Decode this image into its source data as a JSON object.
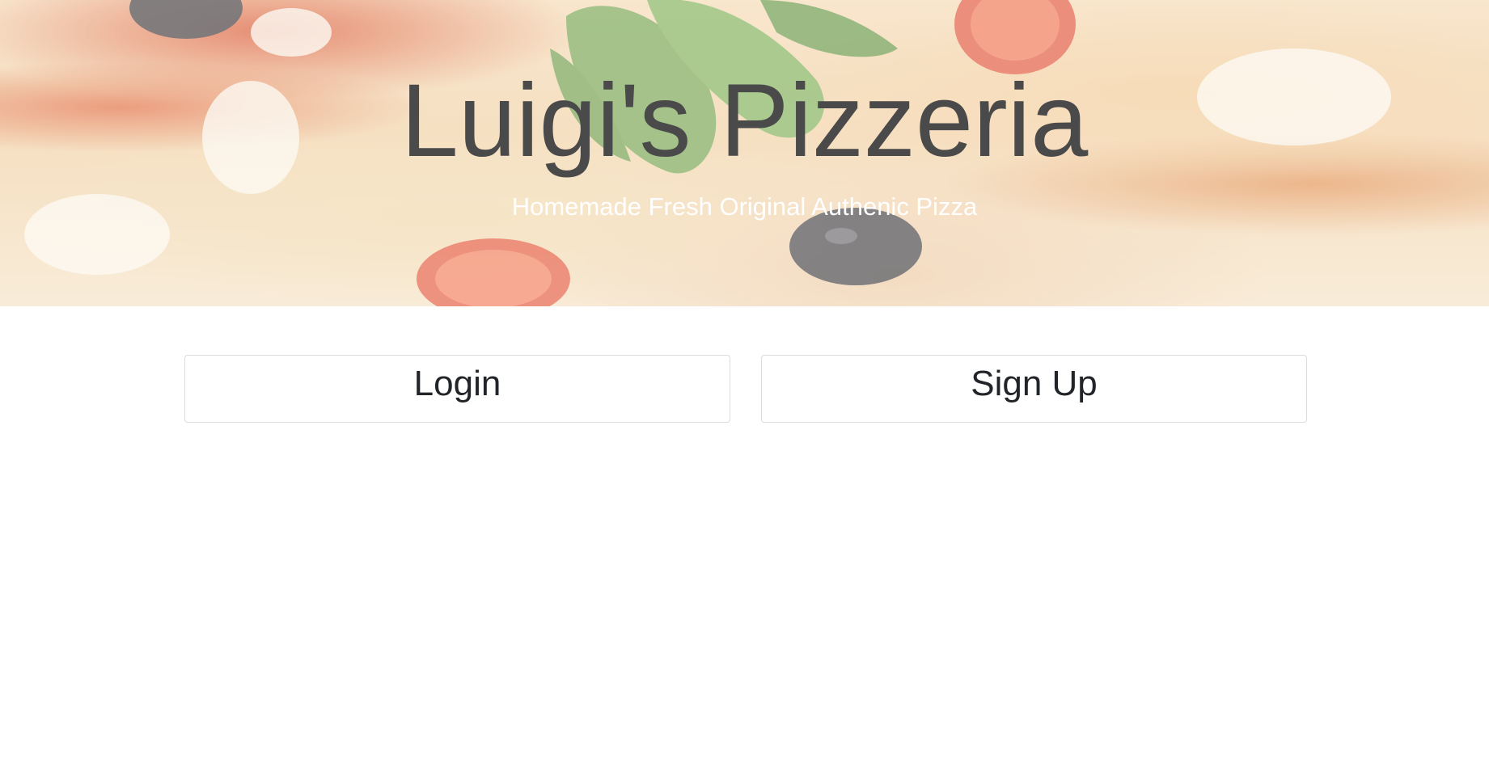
{
  "hero": {
    "title": "Luigi's Pizzeria",
    "subtitle": "Homemade Fresh Original Authenic Pizza",
    "background_image": "pizza-photo"
  },
  "actions": {
    "login_label": "Login",
    "signup_label": "Sign Up"
  },
  "colors": {
    "title_text": "#4a4a4a",
    "subtitle_text": "#ffffff",
    "button_text": "#212529",
    "button_border": "#dcdcdc",
    "page_background": "#ffffff"
  }
}
